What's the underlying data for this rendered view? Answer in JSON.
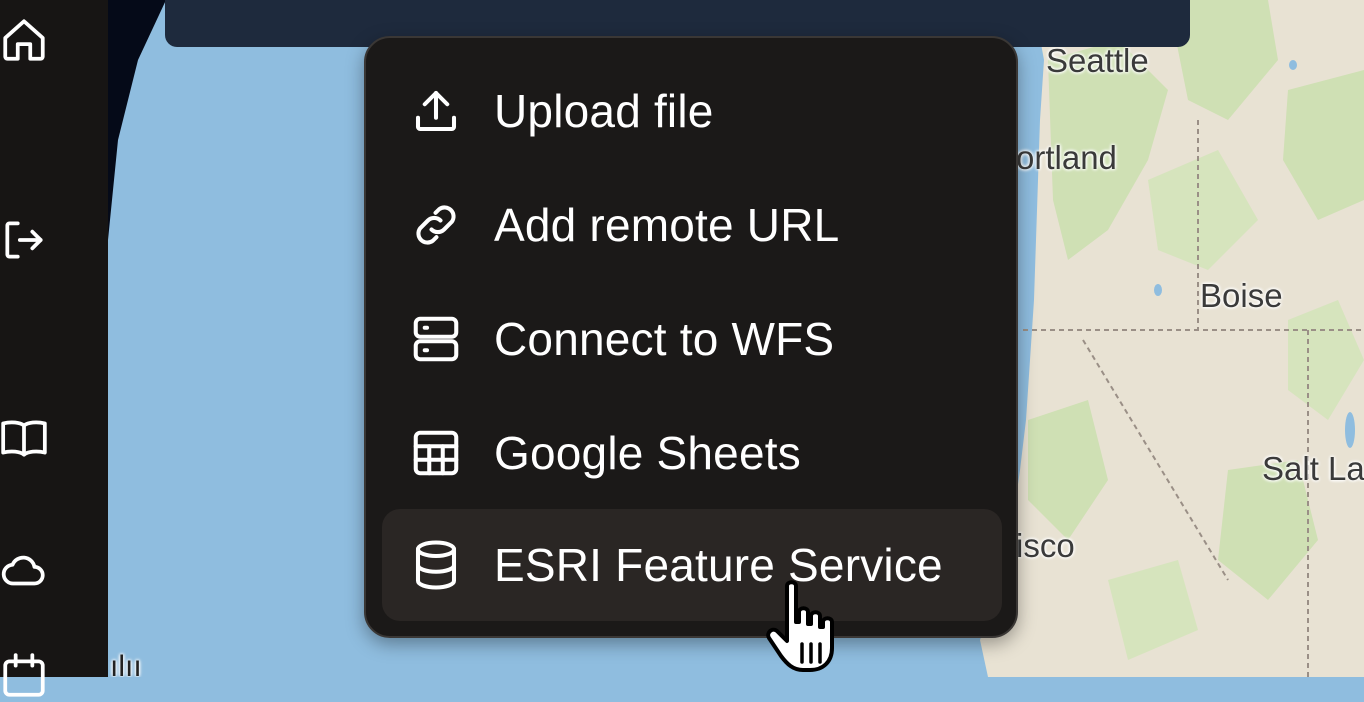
{
  "sidebar": {
    "icons": [
      "home-icon",
      "logout-icon",
      "book-icon",
      "cloud-icon",
      "calendar-icon"
    ]
  },
  "map": {
    "cities": [
      "Seattle",
      "ortland",
      "Boise",
      "Salt La",
      "isco"
    ],
    "scale_text": "ılıı"
  },
  "menu": {
    "items": [
      {
        "label": "Upload file",
        "icon": "upload-icon"
      },
      {
        "label": "Add remote URL",
        "icon": "link-icon"
      },
      {
        "label": "Connect to WFS",
        "icon": "server-icon"
      },
      {
        "label": "Google Sheets",
        "icon": "table-icon"
      },
      {
        "label": "ESRI Feature Service",
        "icon": "database-icon"
      }
    ],
    "active_index": 4
  },
  "colors": {
    "water": "#8fbddf",
    "land": "#e8e2d3",
    "forest": "#cfe0b4",
    "menu_bg": "#1b1918",
    "menu_active": "#2a2624",
    "sidebar": "#171514",
    "topbar": "#1e2a3d"
  }
}
